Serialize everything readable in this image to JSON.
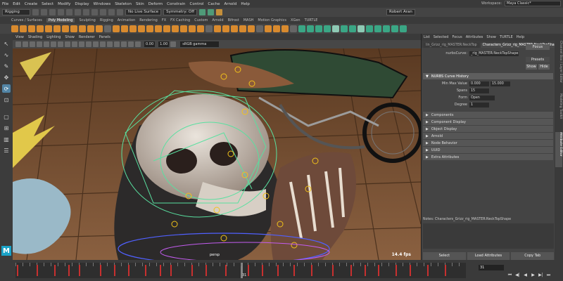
{
  "menu": {
    "items": [
      "File",
      "Edit",
      "Create",
      "Select",
      "Modify",
      "Display",
      "Windows",
      "Skeleton",
      "Skin",
      "Deform",
      "Constrain",
      "Control",
      "Cache",
      "Arnold",
      "Help"
    ],
    "workspace_label": "Workspace:",
    "workspace_value": "Maya Classic*"
  },
  "status": {
    "mode": "Rigging",
    "live_surface": "No Live Surface",
    "symmetry": "Symmetry: Off",
    "user": "Robert Aran"
  },
  "shelf": {
    "tabs": [
      "Curves / Surfaces",
      "Poly Modeling",
      "Sculpting",
      "Rigging",
      "Animation",
      "Rendering",
      "FX",
      "FX Caching",
      "Custom",
      "Arnold",
      "Bifrost",
      "MASH",
      "Motion Graphics",
      "XGen",
      "TURTLE"
    ],
    "active_tab": 1
  },
  "viewport": {
    "menu": [
      "View",
      "Shading",
      "Lighting",
      "Show",
      "Renderer",
      "Panels"
    ],
    "near_value": "0.00",
    "far_value": "1.00",
    "color_space": "sRGB gamma",
    "fps": "14.4 fps",
    "camera": "persp"
  },
  "attribute_editor": {
    "menu": [
      "List",
      "Selected",
      "Focus",
      "Attributes",
      "Show",
      "TURTLE",
      "Help"
    ],
    "tabs": [
      "lin_Grizz_rig_MASTER:NeckTop",
      "Characters_Grizz_rig_MASTER:NeckTopShape"
    ],
    "active_tab": 1,
    "node_label": "nurbsCurve:",
    "node_value": "_rig_MASTER:NeckTopShape",
    "focus_button": "Focus",
    "presets_button": "Presets",
    "show_button": "Show",
    "hide_button": "Hide",
    "open_section": "NURBS Curve History",
    "fields": [
      {
        "label": "Min Max Value",
        "v1": "0.000",
        "v2": "15.000"
      },
      {
        "label": "Spans",
        "v1": "15"
      },
      {
        "label": "Form",
        "v1": "Open"
      },
      {
        "label": "Degree",
        "v1": "1"
      }
    ],
    "sections": [
      "Components",
      "Component Display",
      "Object Display",
      "Arnold",
      "Node Behavior",
      "UUID",
      "Extra Attributes"
    ],
    "notes": "Notes: Characters_Grizz_rig_MASTER:NeckTopShape",
    "footer": [
      "Select",
      "Load Attributes",
      "Copy Tab"
    ]
  },
  "side_tabs": [
    "Channel Box / Layer Editor",
    "Modeling Toolkit",
    "Attribute Editor"
  ],
  "timeline": {
    "current_frame": "31",
    "playhead_label": "31",
    "keys": [
      2,
      30,
      55,
      75,
      90,
      120,
      140,
      160,
      184,
      205,
      220,
      250,
      270,
      298,
      330,
      350,
      372,
      395,
      420,
      450,
      476,
      496,
      515,
      540,
      560,
      585,
      610
    ]
  }
}
